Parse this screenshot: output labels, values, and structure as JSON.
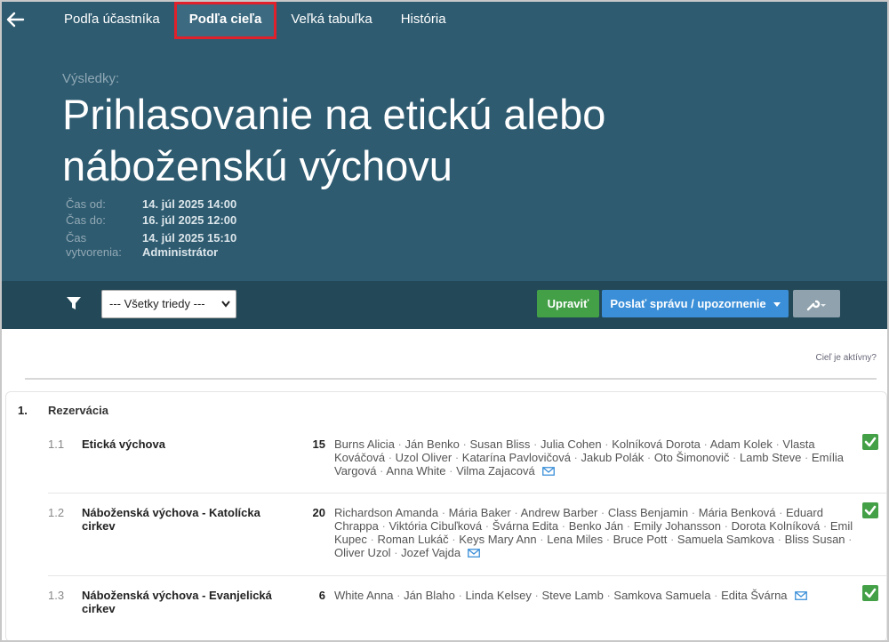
{
  "nav": {
    "tabs": [
      {
        "label": "Podľa účastníka",
        "active": false
      },
      {
        "label": "Podľa cieľa",
        "active": true
      },
      {
        "label": "Veľká tabuľka",
        "active": false
      },
      {
        "label": "História",
        "active": false
      }
    ]
  },
  "header": {
    "subtitle": "Výsledky:",
    "title": "Prihlasovanie na etickú alebo náboženskú výchovu",
    "meta": [
      {
        "label": "Čas od:",
        "value": "14. júl 2025 14:00"
      },
      {
        "label": "Čas do:",
        "value": "16. júl 2025 12:00"
      },
      {
        "label": "Čas vytvorenia:",
        "value": "14. júl 2025 15:10",
        "value2": "Administrátor"
      }
    ]
  },
  "toolbar": {
    "class_select": "--- Všetky triedy ---",
    "edit_label": "Upraviť",
    "send_label": "Poslať správu / upozornenie"
  },
  "content": {
    "active_link": "Cieľ je aktívny?",
    "group": {
      "num": "1.",
      "title": "Rezervácia"
    },
    "items": [
      {
        "num": "1.1",
        "name": "Etická výchova",
        "count": "15",
        "participants": [
          "Burns Alicia",
          "Ján Benko",
          "Susan Bliss",
          "Julia Cohen",
          "Kolníková Dorota",
          "Adam Kolek",
          "Vlasta Kováčová",
          "Uzol Oliver",
          "Katarína Pavlovičová",
          "Jakub Polák",
          "Oto Šimonovič",
          "Lamb Steve",
          "Emília Vargová",
          "Anna White",
          "Vilma Zajacová"
        ]
      },
      {
        "num": "1.2",
        "name": "Náboženská výchova - Katolícka cirkev",
        "count": "20",
        "participants": [
          "Richardson Amanda",
          "Mária Baker",
          "Andrew Barber",
          "Class Benjamin",
          "Mária Benková",
          "Eduard Chrappa",
          "Viktória Cibuľková",
          "Švárna Edita",
          "Benko Ján",
          "Emily Johansson",
          "Dorota Kolníková",
          "Emil Kupec",
          "Roman Lukáč",
          "Keys Mary Ann",
          "Lena Miles",
          "Bruce Pott",
          "Samuela Samkova",
          "Bliss Susan",
          "Oliver Uzol",
          "Jozef Vajda"
        ]
      },
      {
        "num": "1.3",
        "name": "Náboženská výchova - Evanjelická cirkev",
        "count": "6",
        "participants": [
          "White Anna",
          "Ján Blaho",
          "Linda Kelsey",
          "Steve Lamb",
          "Samkova Samuela",
          "Edita Švárna"
        ]
      }
    ]
  },
  "icons": {
    "back": "arrow-left-icon",
    "filter": "filter-icon",
    "tool": "wrench-icon",
    "mail": "envelope-icon",
    "check": "checkbox-checked-icon"
  },
  "colors": {
    "header_bg": "#2e5b70",
    "toolbar_bg": "#234857",
    "edit_button": "#43a047",
    "send_button": "#3b8fd8",
    "tool_button": "#8fa2ad",
    "active_tab_outline": "#e0202a",
    "check": "#43a047"
  }
}
